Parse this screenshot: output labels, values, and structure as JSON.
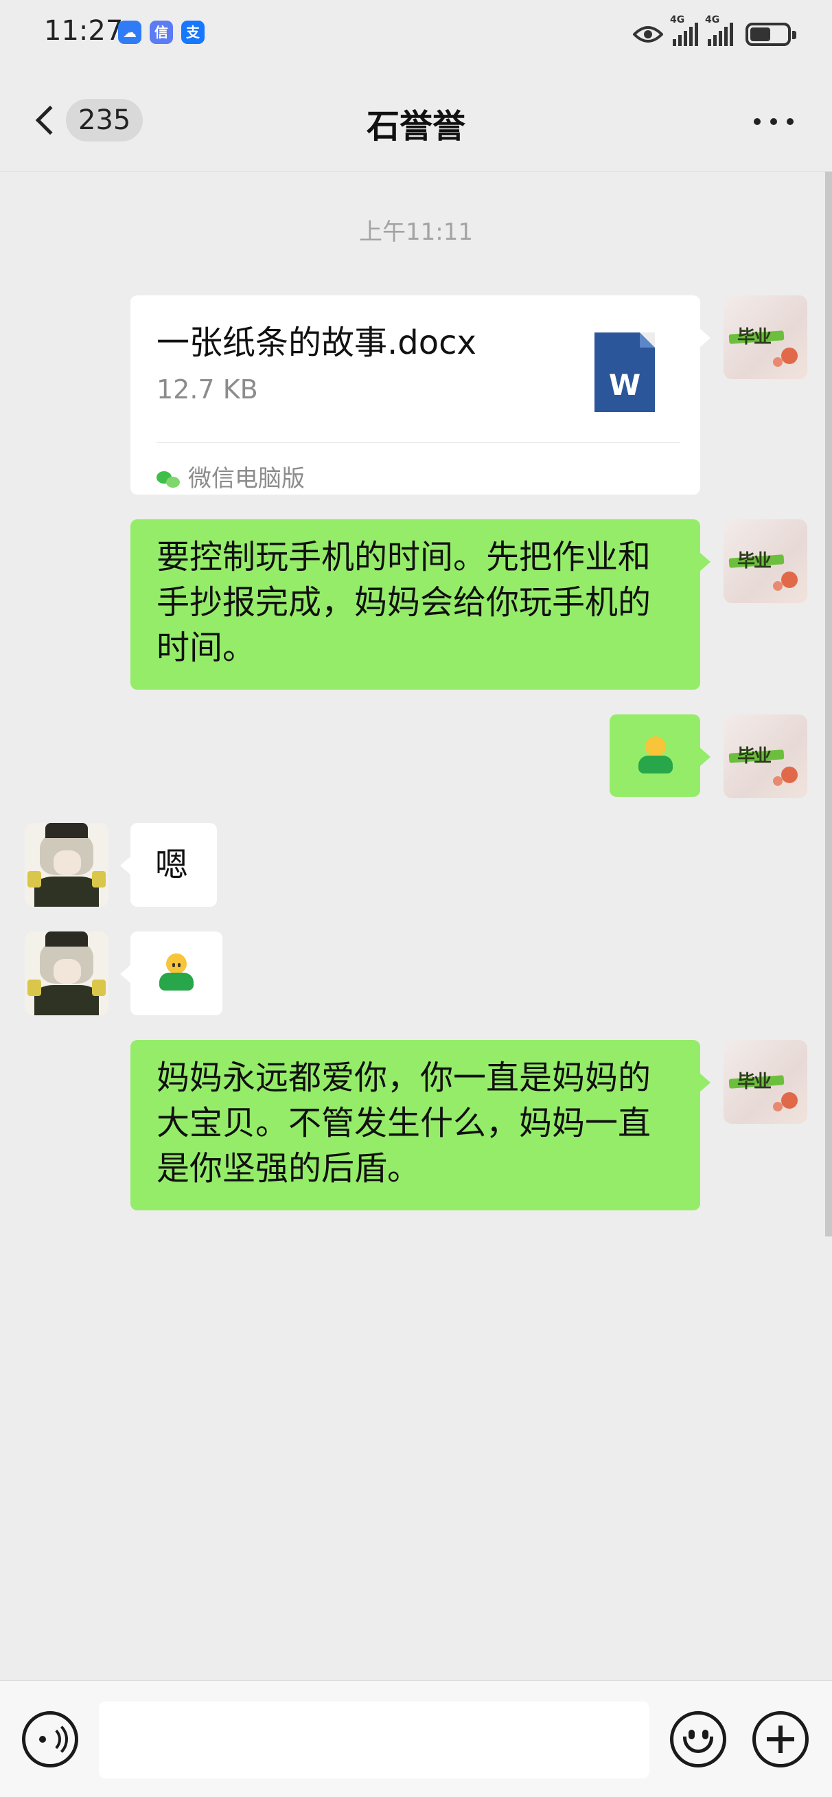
{
  "status_bar": {
    "time": "11:27",
    "app_badges": [
      {
        "icon": "cloud-app-icon",
        "glyph": "☁",
        "color": "#2f7cf6"
      },
      {
        "icon": "finance-app-icon",
        "glyph": "信",
        "color": "#5b7cf2"
      },
      {
        "icon": "alipay-icon",
        "glyph": "支",
        "color": "#1677ff"
      }
    ],
    "network_1": "4G",
    "network_2": "4G",
    "battery_level": 0.55
  },
  "header": {
    "unread_count": "235",
    "title": "石誉誉"
  },
  "messages": {
    "timestamp": "上午11:11",
    "file": {
      "name": "一张纸条的故事.docx",
      "size": "12.7 KB",
      "icon_letter": "W",
      "source": "微信电脑版"
    },
    "text_1": "要控制玩手机的时间。先把作业和手抄报完成，妈妈会给你玩手机的时间。",
    "emoji_1": "person-emoji",
    "reply_text": "嗯",
    "reply_emoji": "person-emoji",
    "text_2": "妈妈永远都爱你，你一直是妈妈的大宝贝。不管发生什么，妈妈一直是你坚强的后盾。"
  },
  "colors": {
    "sent_bubble": "#95ec69",
    "received_bubble": "#ffffff",
    "background": "#ededed"
  }
}
